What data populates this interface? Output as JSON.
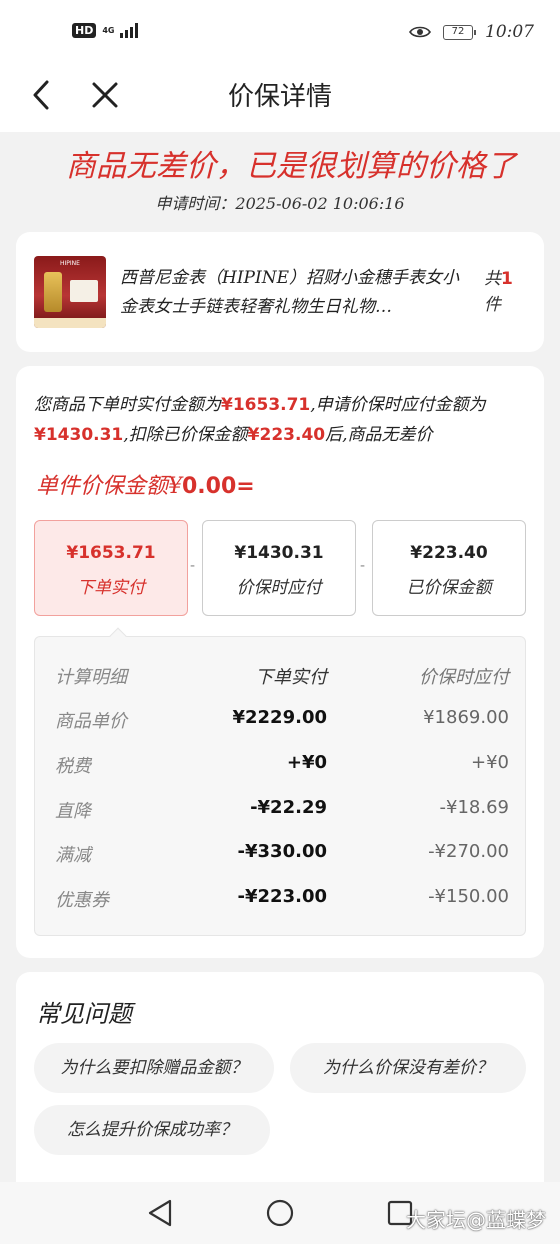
{
  "status_bar": {
    "hd": "HD",
    "network": "4G",
    "battery": "72",
    "time": "10:07"
  },
  "nav": {
    "title": "价保详情"
  },
  "slogan": "商品无差价，已是很划算的价格了",
  "apply_time": "申请时间：2025-06-02 10:06:16",
  "product": {
    "title": "西普尼金表（HIPINE）招财小金穗手表女小金表女士手链表轻奢礼物生日礼物…",
    "qty_prefix": "共",
    "qty": "1",
    "qty_suffix": "件",
    "thumb_brand": "HIPINE"
  },
  "summary": {
    "t1": "您商品下单时实付金额为",
    "a1": "¥1653.71",
    "t2": ",申请价保时应付金额为",
    "a2": "¥1430.31",
    "t3": ",扣除已价保金额",
    "a3": "¥223.40",
    "t4": "后,商品无差价"
  },
  "unit_amount": {
    "label": "单件价保金额¥",
    "value": "0.00",
    "suffix": "="
  },
  "price_boxes": [
    {
      "value": "¥1653.71",
      "label": "下单实付"
    },
    {
      "value": "¥1430.31",
      "label": "价保时应付"
    },
    {
      "value": "¥223.40",
      "label": "已价保金额"
    }
  ],
  "operators": [
    "-",
    "-"
  ],
  "calc": {
    "header": [
      "计算明细",
      "下单实付",
      "价保时应付"
    ],
    "rows": [
      [
        "商品单价",
        "¥2229.00",
        "¥1869.00"
      ],
      [
        "税费",
        "+¥0",
        "+¥0"
      ],
      [
        "直降",
        "-¥22.29",
        "-¥18.69"
      ],
      [
        "满减",
        "-¥330.00",
        "-¥270.00"
      ],
      [
        "优惠券",
        "-¥223.00",
        "-¥150.00"
      ]
    ]
  },
  "faq": {
    "title": "常见问题",
    "chips": [
      "为什么要扣除赠品金额？",
      "为什么价保没有差价？",
      "怎么提升价保成功率？"
    ]
  },
  "watermark": "大家坛@蓝蝶梦"
}
